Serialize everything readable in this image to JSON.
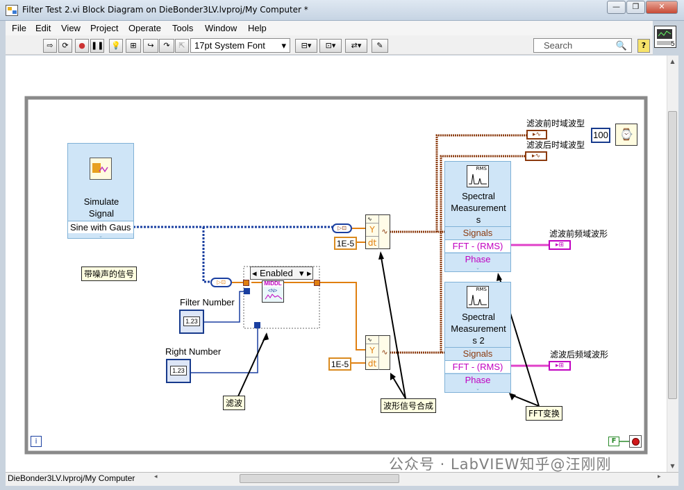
{
  "window": {
    "title": "Filter Test 2.vi Block Diagram on DieBonder3LV.lvproj/My Computer *",
    "buttons": {
      "minimize": "—",
      "restore": "❐",
      "close": "✕"
    }
  },
  "menu": [
    "File",
    "Edit",
    "View",
    "Project",
    "Operate",
    "Tools",
    "Window",
    "Help"
  ],
  "toolbar": {
    "font": "17pt System Font",
    "search_placeholder": "Search",
    "help": "?",
    "icon_badge": "5"
  },
  "diagram": {
    "simulate": {
      "title_line1": "Simulate",
      "title_line2": "Signal",
      "output": "Sine with Gaus"
    },
    "noisy_label": "带噪声的信号",
    "case": {
      "selector": "Enabled"
    },
    "filter_number": {
      "label": "Filter Number",
      "value": "1.23"
    },
    "right_number": {
      "label": "Right Number",
      "value": "1.23"
    },
    "build1": {
      "y": "Y",
      "dt": "dt",
      "const": "1E-5"
    },
    "build2": {
      "y": "Y",
      "dt": "dt",
      "const": "1E-5"
    },
    "spectral1": {
      "title_line1": "Spectral",
      "title_line2": "Measurement",
      "title_line3": "s",
      "signals": "Signals",
      "fft": "FFT - (RMS)",
      "phase": "Phase",
      "badge": "RMS"
    },
    "spectral2": {
      "title_line1": "Spectral",
      "title_line2": "Measurement",
      "title_line3": "s 2",
      "signals": "Signals",
      "fft": "FFT - (RMS)",
      "phase": "Phase",
      "badge": "RMS"
    },
    "labels": {
      "time_before": "滤波前时域波型",
      "time_after": "滤波后时域波型",
      "freq_before": "滤波前频域波形",
      "freq_after": "滤波后频域波形"
    },
    "notes": {
      "filter": "滤波",
      "synth": "波形信号合成",
      "fft": "FFT变换"
    },
    "wait_const": "100",
    "filter_text": "MIDDL",
    "stop_bool": "F",
    "info": "i"
  },
  "status": {
    "path": "DieBonder3LV.lvproj/My Computer"
  },
  "watermark": "公众号 · LabVIEW知乎@汪刚刚",
  "colors": {
    "wire_blue": "#1a3fa0",
    "wire_orange": "#e07f10",
    "wire_brown": "#8b3a0e",
    "wire_pink": "#e040c8",
    "node_fill": "#cfe5f7"
  }
}
